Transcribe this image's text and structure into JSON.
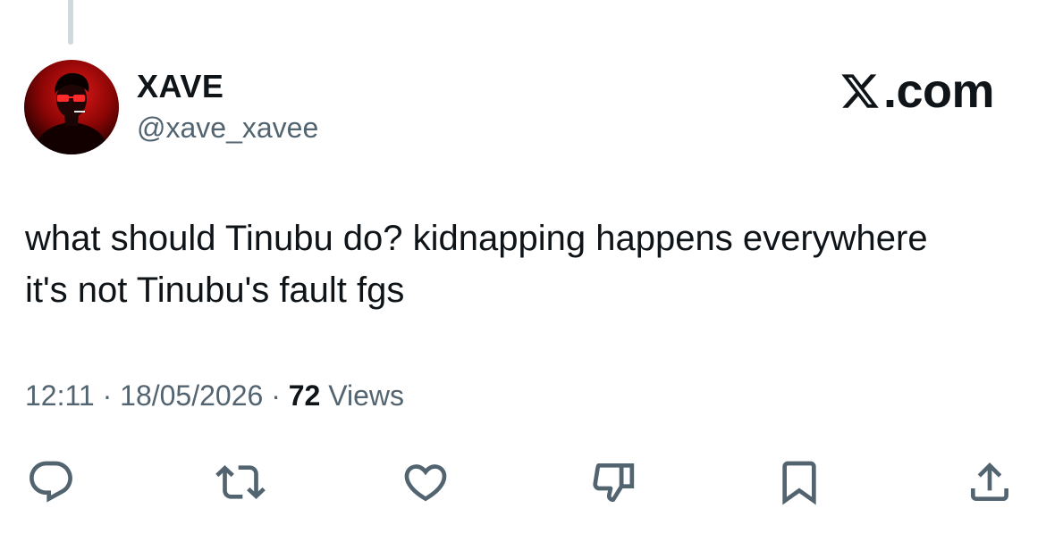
{
  "author": {
    "display_name": "XAVE",
    "handle": "@xave_xavee",
    "avatar_icon": "avatar-red-glow-portrait"
  },
  "brand": {
    "logo_icon": "x-logo-icon",
    "text": ".com"
  },
  "tweet": {
    "text": "what should Tinubu do? kidnapping happens everywhere\nit's not Tinubu's fault fgs"
  },
  "meta": {
    "time": "12:11",
    "separator": "·",
    "date": "18/05/2026",
    "views_count": "72",
    "views_label": " Views"
  },
  "actions": [
    {
      "icon": "reply-icon"
    },
    {
      "icon": "retweet-icon"
    },
    {
      "icon": "like-icon"
    },
    {
      "icon": "dislike-icon"
    },
    {
      "icon": "bookmark-icon"
    },
    {
      "icon": "share-icon"
    }
  ],
  "colors": {
    "text_primary": "#0f1419",
    "text_secondary": "#536471",
    "icon": "#536471",
    "thread_line": "#cfd9de",
    "avatar_red": "#e01818"
  }
}
